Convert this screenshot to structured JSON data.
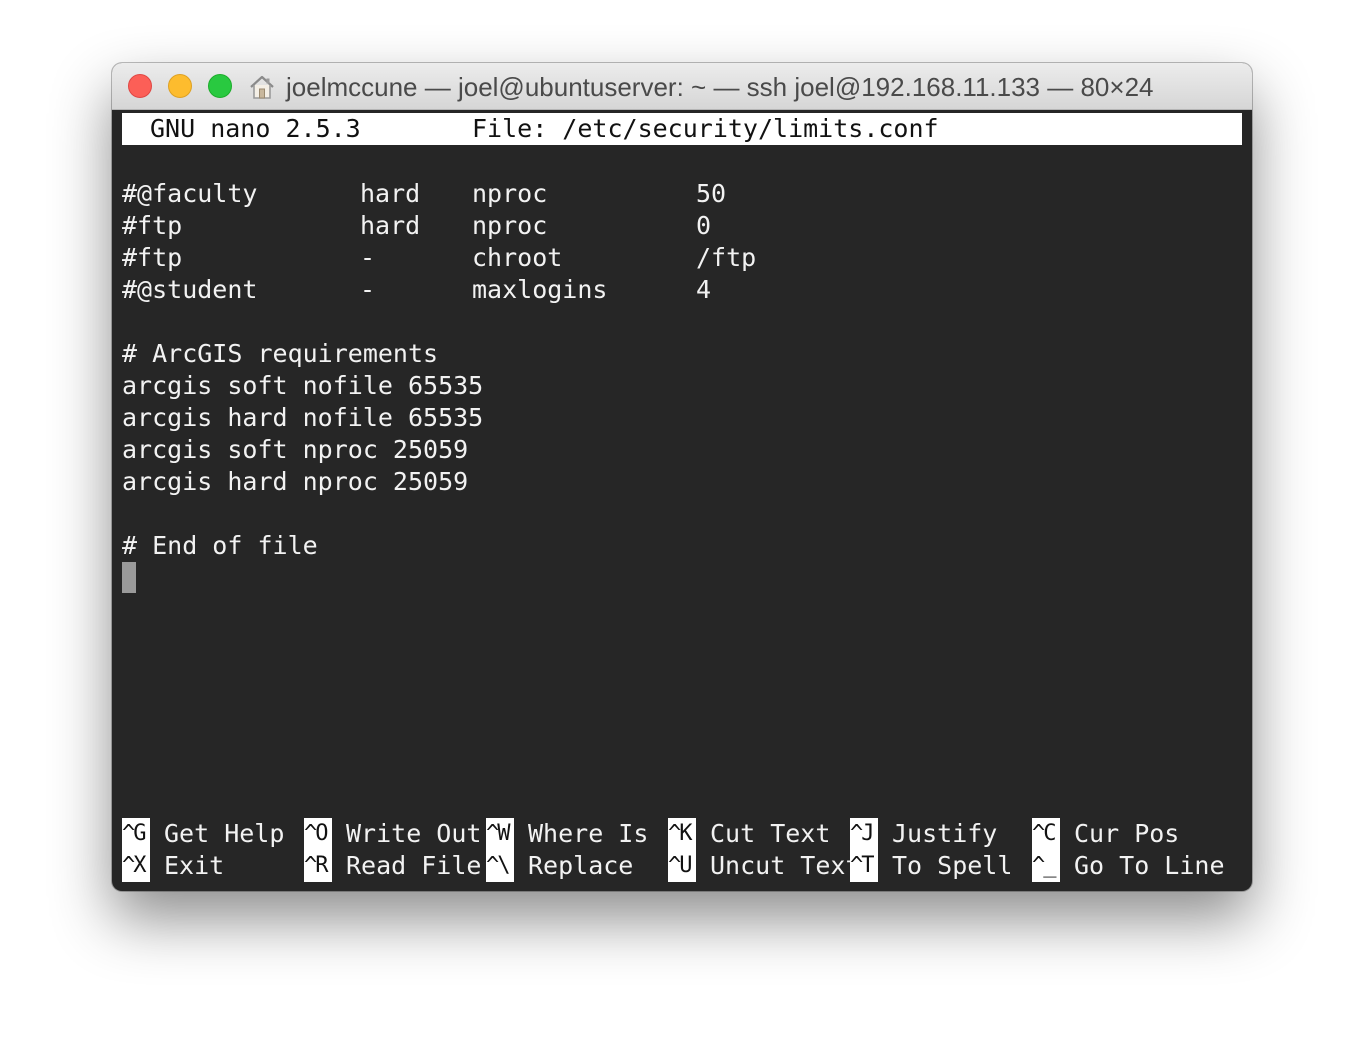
{
  "window": {
    "title": "joelmccune — joel@ubuntuserver: ~ — ssh joel@192.168.11.133 — 80×24"
  },
  "nano": {
    "version": "GNU nano 2.5.3",
    "file": "File: /etc/security/limits.conf"
  },
  "file_lines": {
    "faculty": [
      "#@faculty",
      "hard",
      "nproc",
      "50"
    ],
    "ftp1": [
      "#ftp",
      "hard",
      "nproc",
      "0"
    ],
    "ftp2": [
      "#ftp",
      "-",
      "chroot",
      "/ftp"
    ],
    "student": [
      "#@student",
      "-",
      "maxlogins",
      "4"
    ],
    "arcgis_comment": "# ArcGIS requirements",
    "arcgis1": "arcgis soft nofile 65535",
    "arcgis2": "arcgis hard nofile 65535",
    "arcgis3": "arcgis soft nproc 25059",
    "arcgis4": "arcgis hard nproc 25059",
    "end_comment": "# End of file"
  },
  "shortcuts": [
    {
      "key": "^G",
      "label": "Get Help"
    },
    {
      "key": "^O",
      "label": "Write Out"
    },
    {
      "key": "^W",
      "label": "Where Is"
    },
    {
      "key": "^K",
      "label": "Cut Text"
    },
    {
      "key": "^J",
      "label": "Justify"
    },
    {
      "key": "^C",
      "label": "Cur Pos"
    },
    {
      "key": "^X",
      "label": "Exit"
    },
    {
      "key": "^R",
      "label": "Read File"
    },
    {
      "key": "^\\",
      "label": "Replace"
    },
    {
      "key": "^U",
      "label": "Uncut Text"
    },
    {
      "key": "^T",
      "label": "To Spell"
    },
    {
      "key": "^_",
      "label": "Go To Line"
    }
  ]
}
